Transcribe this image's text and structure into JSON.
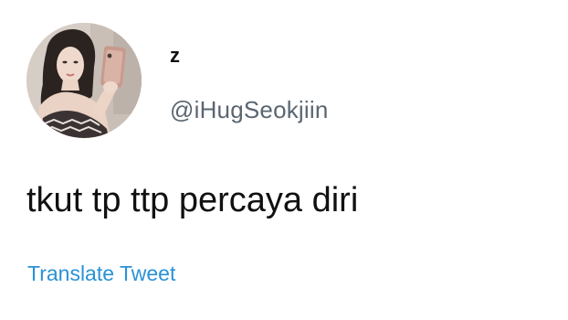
{
  "tweet": {
    "display_name": "z",
    "handle": "@iHugSeokjiin",
    "text": "tkut tp ttp percaya diri",
    "translate_label": "Translate Tweet"
  },
  "colors": {
    "background": "#ffffff",
    "text_primary": "#111111",
    "text_secondary": "#5b6670",
    "link": "#2a92d6"
  }
}
